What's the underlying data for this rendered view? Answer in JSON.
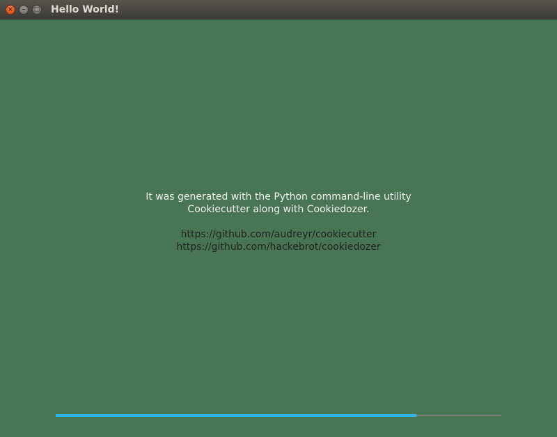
{
  "window": {
    "title": "Hello World!",
    "buttons": {
      "close": "×",
      "minimize": "–",
      "maximize": "□"
    }
  },
  "content": {
    "line1": "It was generated with the Python command-line utility",
    "line2": "Cookiecutter along with Cookiedozer.",
    "link1": "https://github.com/audreyr/cookiecutter",
    "link2": "https://github.com/hackebrot/cookiedozer"
  },
  "progress": {
    "value_percent": 81
  },
  "colors": {
    "background": "#487553",
    "progress_fill": "#33b5e5",
    "progress_track": "#808080",
    "text_light": "#f1f1f1",
    "text_dark": "#222222"
  }
}
